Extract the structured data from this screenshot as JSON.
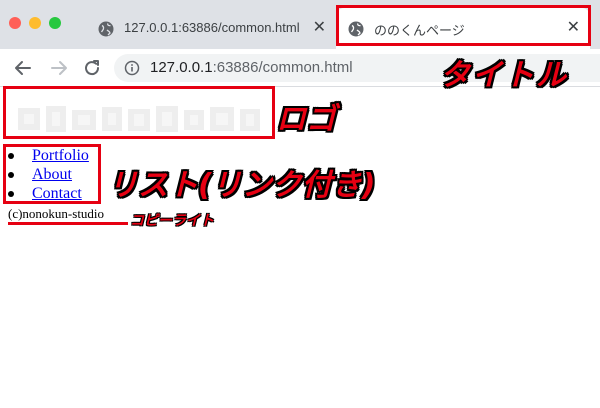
{
  "browser": {
    "tabs": [
      {
        "label": "127.0.0.1:63886/common.html",
        "icon": "globe-icon",
        "active": false
      },
      {
        "label": "ののくんページ",
        "icon": "globe-icon",
        "active": true
      }
    ],
    "close_glyph": "✕",
    "address": {
      "host": "127.0.0.1",
      "rest": ":63886/common.html"
    }
  },
  "page": {
    "logo": "logo-image",
    "nav_items": [
      "Portfolio",
      "About",
      "Contact"
    ],
    "copyright": "(c)nonokun-studio"
  },
  "annotations": {
    "title": "タイトル",
    "logo": "ロゴ",
    "list": "リスト(リンク付き)",
    "copyright": "コピーライト"
  },
  "colors": {
    "annotation_red": "#e60012",
    "link": "#0000ee",
    "chrome_bar": "#dee1e6"
  }
}
